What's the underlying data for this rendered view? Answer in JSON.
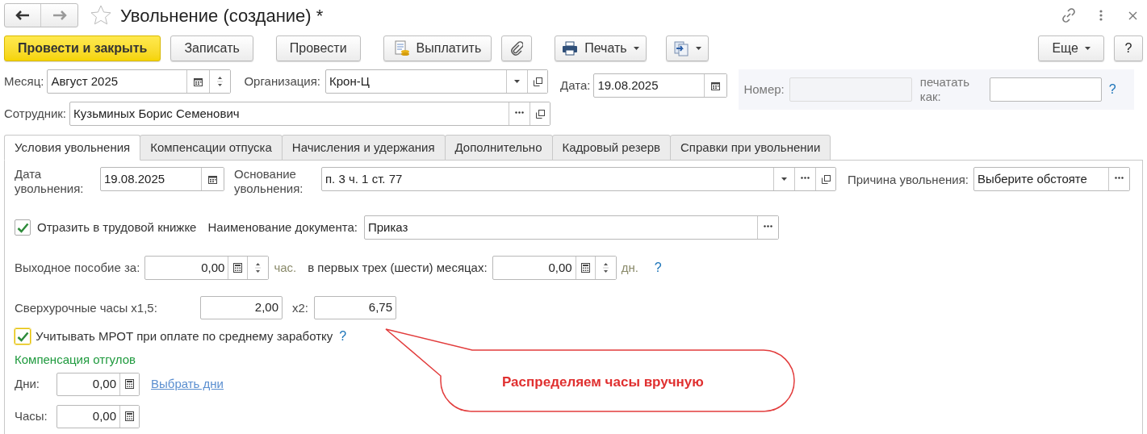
{
  "window": {
    "title": "Увольнение (создание) *"
  },
  "toolbar": [
    {
      "kind": "primary",
      "label": "Провести и закрыть"
    },
    {
      "kind": "plain",
      "label": "Записать"
    },
    {
      "kind": "plain",
      "label": "Провести"
    },
    {
      "kind": "pay",
      "label": "Выплатить"
    },
    {
      "kind": "clip"
    },
    {
      "kind": "print",
      "label": "Печать"
    },
    {
      "kind": "export"
    }
  ],
  "toolbar_right": [
    {
      "kind": "menu",
      "label": "Еще"
    },
    {
      "kind": "plain",
      "label": "?"
    }
  ],
  "header": {
    "month": {
      "label": "Месяц:",
      "value": "Август 2025"
    },
    "organization": {
      "label": "Организация:",
      "value": "Крон-Ц"
    },
    "date": {
      "label": "Дата:",
      "value": "19.08.2025"
    },
    "number": {
      "label": "Номер:",
      "disabled": true
    },
    "print_as": {
      "label": "печатать как:"
    },
    "help": "?",
    "employee": {
      "label": "Сотрудник:",
      "value": "Кузьминых Борис Семенович"
    }
  },
  "tabs": [
    {
      "label": "Условия увольнения",
      "selected": true
    },
    {
      "label": "Компенсации отпуска",
      "selected": false
    },
    {
      "label": "Начисления и удержания",
      "selected": false
    },
    {
      "label": "Дополнительно",
      "selected": false
    },
    {
      "label": "Кадровый резерв",
      "selected": false
    },
    {
      "label": "Справки при увольнении",
      "selected": false
    }
  ],
  "form": {
    "dismissal_date": {
      "label": "Дата увольнения:",
      "value": "19.08.2025"
    },
    "basis": {
      "label": "Основание увольнения:",
      "value": "п. 3 ч. 1 ст. 77"
    },
    "reason": {
      "label": "Причина увольнения:",
      "value": "Выберите обстояте"
    },
    "work_book": {
      "label": "Отразить в трудовой книжке",
      "checked": true
    },
    "doc_name": {
      "label": "Наименование документа:",
      "value": "Приказ"
    },
    "severance": {
      "label": "Выходное пособие за:",
      "value": "0,00",
      "unit": "час."
    },
    "first_months": {
      "label": "в первых трех (шести) месяцах:",
      "value": "0,00",
      "unit": "дн.",
      "help": "?"
    },
    "overtime15": {
      "label": "Сверхурочные часы х1,5:",
      "value": "2,00"
    },
    "overtime2": {
      "label": "х2:",
      "value": "6,75"
    },
    "mrot": {
      "label": "Учитывать МРОТ при оплате по среднему заработку",
      "checked": true,
      "help": "?"
    },
    "comp_title": "Компенсация отгулов",
    "days": {
      "label": "Дни:",
      "value": "0,00",
      "link": "Выбрать дни"
    },
    "hours": {
      "label": "Часы:",
      "value": "0,00"
    }
  },
  "callout": "Распределяем часы вручную"
}
